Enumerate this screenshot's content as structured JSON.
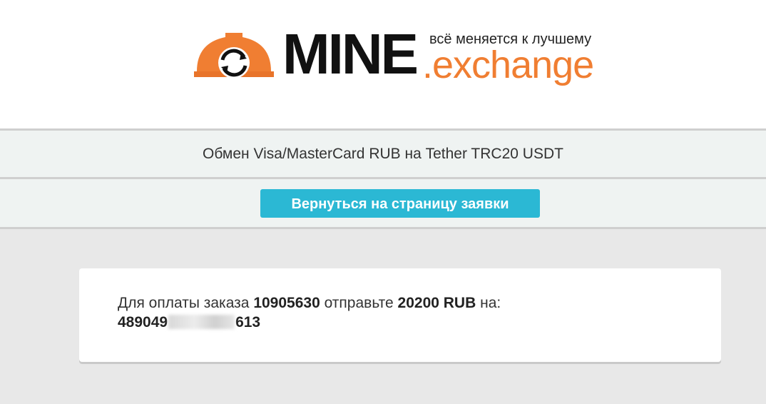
{
  "brand": {
    "name_main": "MINE",
    "name_suffix": ".exchange",
    "tagline": "всё меняется к лучшему",
    "accent_color": "#f07e32",
    "icon": "hardhat-exchange-logo"
  },
  "exchange": {
    "title": "Обмен Visa/MasterCard RUB на Tether TRC20 USDT",
    "back_button_label": "Вернуться на страницу заявки",
    "button_color": "#2bb8d4"
  },
  "payment": {
    "prefix": "Для оплаты заказа",
    "order_number": "10905630",
    "middle": "отправьте",
    "amount": "20200 RUB",
    "suffix": "на:",
    "card_start": "489049",
    "card_end": "613"
  }
}
